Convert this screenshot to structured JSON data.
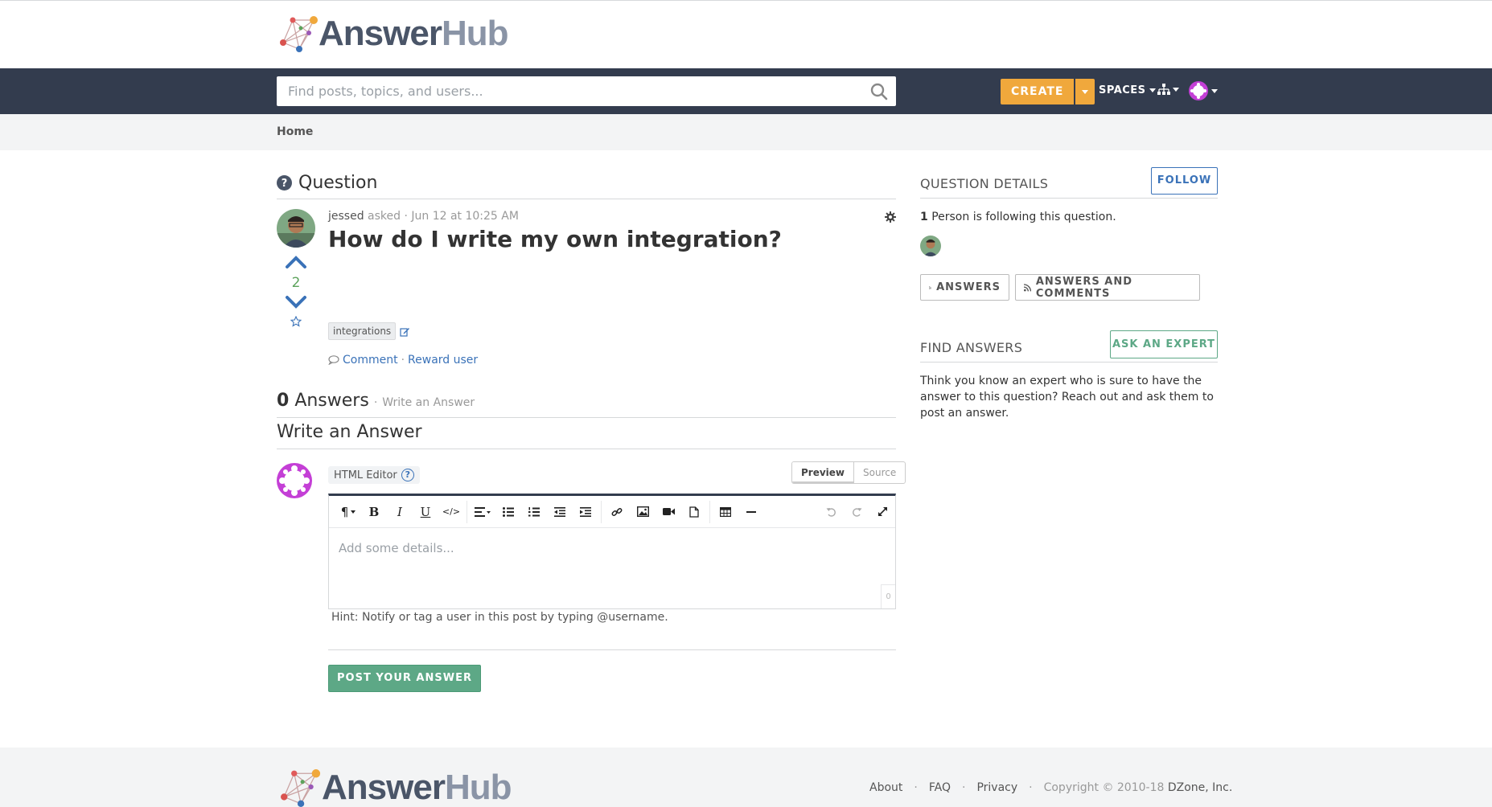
{
  "brand": {
    "name_part1": "Answer",
    "name_part2": "Hub"
  },
  "nav": {
    "search_placeholder": "Find posts, topics, and users...",
    "create_label": "CREATE",
    "spaces_label": "SPACES"
  },
  "breadcrumb": {
    "home": "Home"
  },
  "question": {
    "section_title": "Question",
    "author": "jessed",
    "asked_word": "asked",
    "asked_time": "· Jun 12 at 10:25 AM",
    "title": "How do I write my own integration?",
    "votes": "2",
    "tag": "integrations",
    "comment_label": "Comment",
    "reward_label": "Reward user",
    "separator": "·"
  },
  "answers": {
    "count": "0",
    "count_label": "Answers",
    "separator": "·",
    "write_link": "Write an Answer",
    "write_heading": "Write an Answer"
  },
  "editor": {
    "mode_label": "HTML Editor",
    "help_glyph": "?",
    "preview_tab": "Preview",
    "source_tab": "Source",
    "placeholder": "Add some details...",
    "char_count": "0",
    "hint": "Hint: Notify or tag a user in this post by typing @username.",
    "submit_label": "POST YOUR ANSWER"
  },
  "sidebar": {
    "details_title": "QUESTION DETAILS",
    "follow_label": "FOLLOW",
    "followers_count": "1",
    "followers_text": "Person is following this question.",
    "rss_answers": "ANSWERS",
    "rss_answers_comments": "ANSWERS AND COMMENTS",
    "find_title": "FIND ANSWERS",
    "ask_expert_label": "ASK AN EXPERT",
    "find_text": "Think you know an expert who is sure to have the answer to this question? Reach out and ask them to post an answer."
  },
  "footer": {
    "about": "About",
    "faq": "FAQ",
    "privacy": "Privacy",
    "dot": "·",
    "copyright": "Copyright © 2010-18",
    "company": "DZone, Inc."
  },
  "colors": {
    "nav_bg": "#333c4e",
    "create": "#f0a83c",
    "link": "#3a72b8",
    "accent_green": "#5da886",
    "vote_green": "#5da35c"
  }
}
